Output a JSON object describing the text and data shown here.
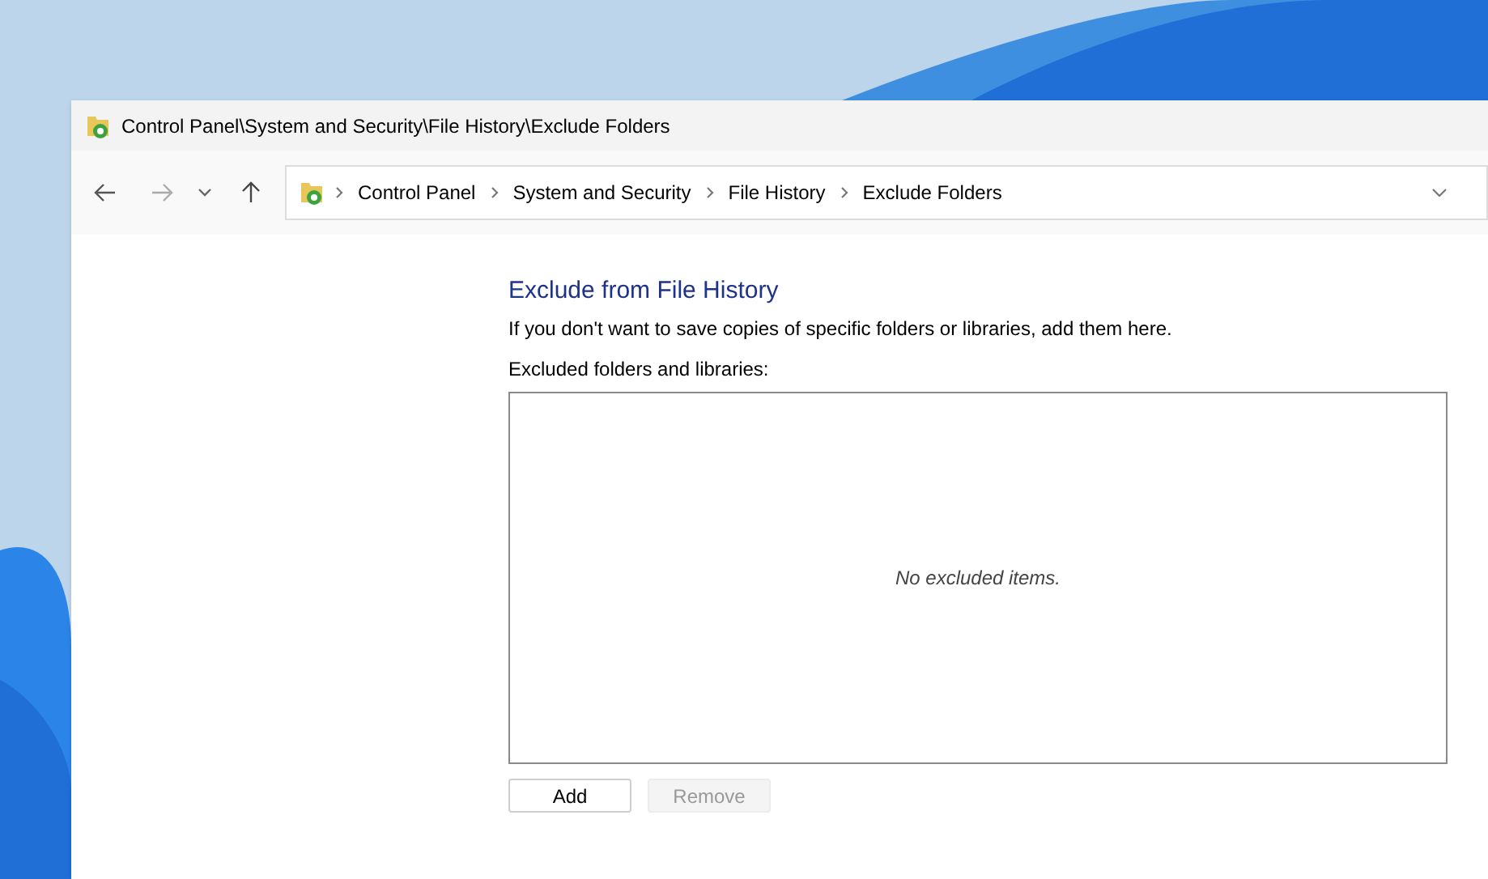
{
  "window": {
    "title": "Control Panel\\System and Security\\File History\\Exclude Folders"
  },
  "navigation": {
    "back": {
      "disabled": false
    },
    "forward": {
      "disabled": true
    }
  },
  "address_bar": {
    "breadcrumbs": [
      "Control Panel",
      "System and Security",
      "File History",
      "Exclude Folders"
    ]
  },
  "content": {
    "heading": "Exclude from File History",
    "description": "If you don't want to save copies of specific folders or libraries, add them here.",
    "list_label": "Excluded folders and libraries:",
    "list": {
      "empty_text": "No excluded items."
    },
    "buttons": [
      {
        "label": "Add",
        "disabled": false
      },
      {
        "label": "Remove",
        "disabled": true
      }
    ]
  }
}
